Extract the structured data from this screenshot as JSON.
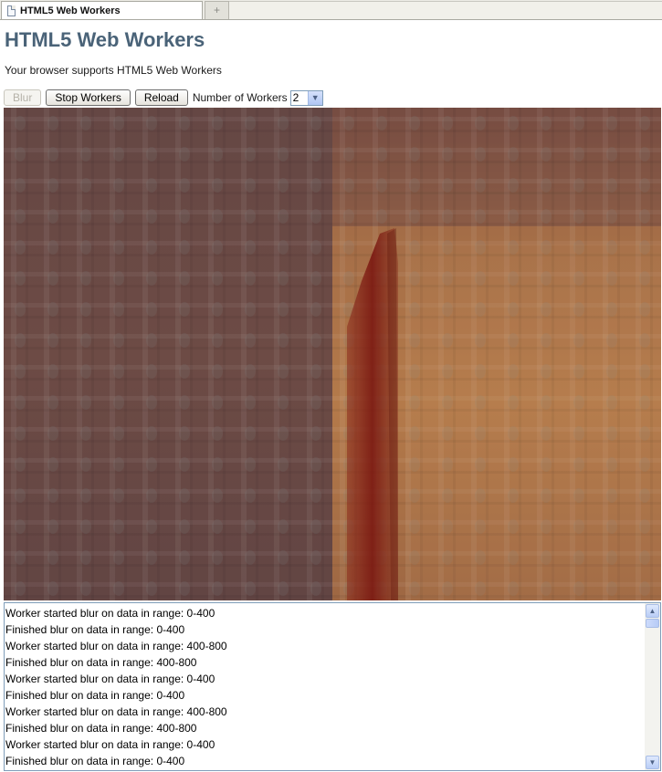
{
  "tab": {
    "title": "HTML5 Web Workers",
    "new_tab_icon": "+"
  },
  "page": {
    "heading": "HTML5 Web Workers",
    "support_text": "Your browser supports HTML5 Web Workers"
  },
  "controls": {
    "blur_label": "Blur",
    "stop_label": "Stop Workers",
    "reload_label": "Reload",
    "workers_label": "Number of Workers",
    "workers_value": "2"
  },
  "icons": {
    "dropdown": "chevron-down-icon",
    "scroll_up": "scroll-up-icon",
    "scroll_down": "scroll-down-icon"
  },
  "colors": {
    "heading": "#4a6378",
    "canvas_left": "#6a4a45",
    "canvas_right": "#b06a3a",
    "streak": "#7e1a10"
  },
  "log": [
    "Worker started blur on data in range: 0-400",
    "Finished blur on data in range: 0-400",
    "Worker started blur on data in range: 400-800",
    "Finished blur on data in range: 400-800",
    "Worker started blur on data in range: 0-400",
    "Finished blur on data in range: 0-400",
    "Worker started blur on data in range: 400-800",
    "Finished blur on data in range: 400-800",
    "Worker started blur on data in range: 0-400",
    "Finished blur on data in range: 0-400"
  ]
}
